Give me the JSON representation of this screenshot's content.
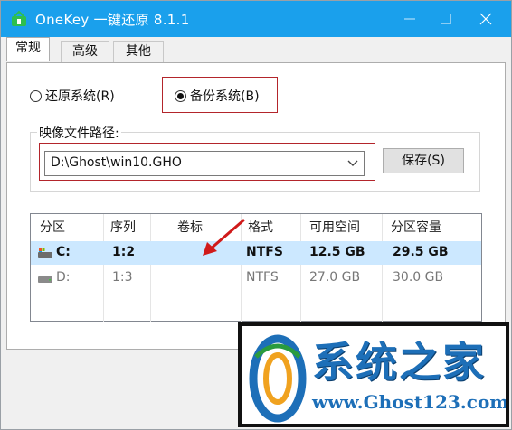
{
  "window": {
    "title": "OneKey 一键还原 8.1.1",
    "accent_color": "#1aa0ec"
  },
  "tabs": [
    {
      "label": "常规",
      "active": true
    },
    {
      "label": "高级",
      "active": false
    },
    {
      "label": "其他",
      "active": false
    }
  ],
  "mode": {
    "restore_label": "还原系统(R)",
    "backup_label": "备份系统(B)",
    "selected": "backup"
  },
  "image_path": {
    "group_label": "映像文件路径:",
    "value": "D:\\Ghost\\win10.GHO",
    "save_button": "保存(S)"
  },
  "partitions": {
    "columns": [
      "分区",
      "序列",
      "卷标",
      "格式",
      "可用空间",
      "分区容量"
    ],
    "rows": [
      {
        "partition": "C:",
        "sequence": "1:2",
        "label": "",
        "format": "NTFS",
        "free": "12.5 GB",
        "capacity": "29.5 GB",
        "selected": true
      },
      {
        "partition": "D:",
        "sequence": "1:3",
        "label": "",
        "format": "NTFS",
        "free": "27.0 GB",
        "capacity": "30.0 GB",
        "selected": false
      }
    ]
  },
  "watermark": {
    "title": "系统之家",
    "url": "www.Ghost123.com"
  },
  "icons": [
    "onekey-app-icon",
    "minimize-icon",
    "maximize-icon",
    "close-icon",
    "chevron-down-icon",
    "system-drive-icon",
    "drive-icon",
    "red-arrow",
    "watermark-logo"
  ]
}
